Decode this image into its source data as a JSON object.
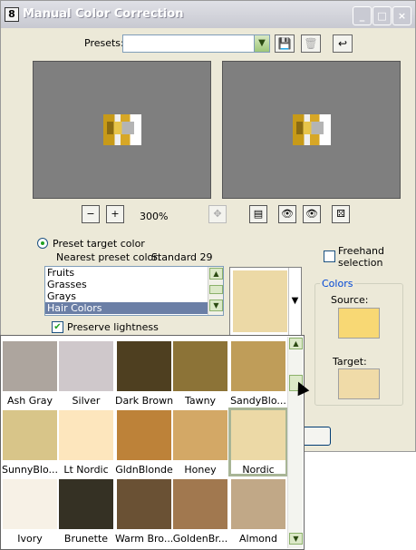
{
  "window": {
    "title": "Manual Color Correction",
    "app_icon_label": "8"
  },
  "presets": {
    "label": "Presets:",
    "value": ""
  },
  "zoom": {
    "level": "300%"
  },
  "target": {
    "radio_label": "Preset target color",
    "nearest_label": "Nearest preset color:",
    "nearest_value": "Standard 29",
    "categories": [
      "Fruits",
      "Grasses",
      "Grays",
      "Hair Colors"
    ],
    "selected_category": "Hair Colors",
    "selected_color": "#ecd9a6"
  },
  "freehand": {
    "label_line1": "Freehand",
    "label_line2": "selection",
    "checked": false
  },
  "preserve_lightness": {
    "label": "Preserve lightness",
    "checked": true
  },
  "colors": {
    "title": "Colors",
    "source_label": "Source:",
    "source_color": "#f8d874",
    "target_label": "Target:",
    "target_color": "#f0dba8"
  },
  "palette": {
    "selected": "Nordic",
    "swatches": [
      {
        "name": "Ash Gray",
        "color": "#ada59e"
      },
      {
        "name": "Silver",
        "color": "#cfc8cb"
      },
      {
        "name": "Dark Brown",
        "color": "#4e3f20"
      },
      {
        "name": "Tawny",
        "color": "#8c7337"
      },
      {
        "name": "SandyBlo...",
        "color": "#bf9d59"
      },
      {
        "name": "SunnyBlo...",
        "color": "#d8c589"
      },
      {
        "name": "Lt Nordic",
        "color": "#fde6bd"
      },
      {
        "name": "GldnBlonde",
        "color": "#bd8239"
      },
      {
        "name": "Honey",
        "color": "#d3a866"
      },
      {
        "name": "Nordic",
        "color": "#ecd9a6"
      },
      {
        "name": "Ivory",
        "color": "#f7f1e6"
      },
      {
        "name": "Brunette",
        "color": "#353124"
      },
      {
        "name": "Warm Bro...",
        "color": "#6a5134"
      },
      {
        "name": "GoldenBr...",
        "color": "#a1784f"
      },
      {
        "name": "Almond",
        "color": "#c1a887"
      }
    ]
  }
}
